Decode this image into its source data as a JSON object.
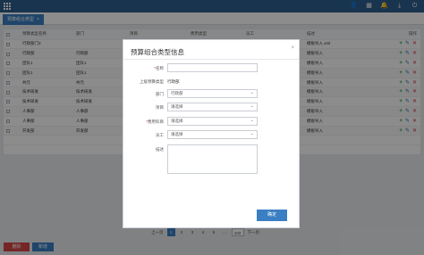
{
  "topbar": {
    "icons": [
      "user-icon",
      "calendar-icon",
      "bell-icon",
      "download-icon",
      "power-icon"
    ],
    "glyphs": [
      "👤",
      "▦",
      "🔔",
      "⤓",
      "⏻"
    ]
  },
  "tab": {
    "label": "预算组合类型",
    "close": "×"
  },
  "table": {
    "headers": [
      "",
      "预算类型名称",
      "部门",
      "项目",
      "费用类型",
      "员工",
      "描述",
      "操作"
    ],
    "rows": [
      [
        "",
        "行政部门3",
        "",
        "",
        "",
        "",
        "模板导入.xml",
        ""
      ],
      [
        "",
        "行政部",
        "行政部",
        "",
        "",
        "",
        "模板导入",
        ""
      ],
      [
        "",
        "团队1",
        "团队1",
        "",
        "",
        "",
        "模板导入",
        ""
      ],
      [
        "",
        "团队1",
        "团队1",
        "",
        "",
        "",
        "模板导入",
        ""
      ],
      [
        "",
        "共元",
        "共元",
        "",
        "",
        "",
        "模板导入",
        ""
      ],
      [
        "",
        "技术研发",
        "技术研发",
        "",
        "",
        "",
        "模板导入",
        ""
      ],
      [
        "",
        "技术研发",
        "技术研发",
        "",
        "",
        "",
        "模板导入",
        ""
      ],
      [
        "",
        "人事部",
        "人事部",
        "",
        "",
        "",
        "模板导入",
        ""
      ],
      [
        "",
        "人事部",
        "人事部",
        "",
        "",
        "",
        "模板导入",
        ""
      ],
      [
        "",
        "开发部",
        "开发部",
        "",
        "",
        "",
        "模板导入",
        ""
      ],
      [
        "",
        "",
        "",
        "",
        "",
        "",
        "",
        ""
      ]
    ],
    "ops": {
      "add": "+",
      "edit": "✎",
      "delete": "✕"
    }
  },
  "pager": {
    "prev": "上一页",
    "pages": [
      "1",
      "2",
      "3",
      "4",
      "5",
      "...",
      "102"
    ],
    "active": "1",
    "next": "下一页"
  },
  "buttons": {
    "delete": "删除",
    "add": "新增"
  },
  "modal": {
    "title": "预算组合类型信息",
    "close": "×",
    "fields": {
      "name_label": "名称",
      "name_required": "*",
      "parent_label": "上级预算类型",
      "parent_value": "行政部",
      "dept_label": "部门",
      "dept_value": "行政部",
      "project_label": "项目",
      "project_placeholder": "请选择",
      "cost_label": "费用科目",
      "cost_required": "*",
      "cost_placeholder": "请选择",
      "staff_label": "员工",
      "staff_placeholder": "请选择",
      "desc_label": "描述"
    },
    "confirm": "确定"
  }
}
